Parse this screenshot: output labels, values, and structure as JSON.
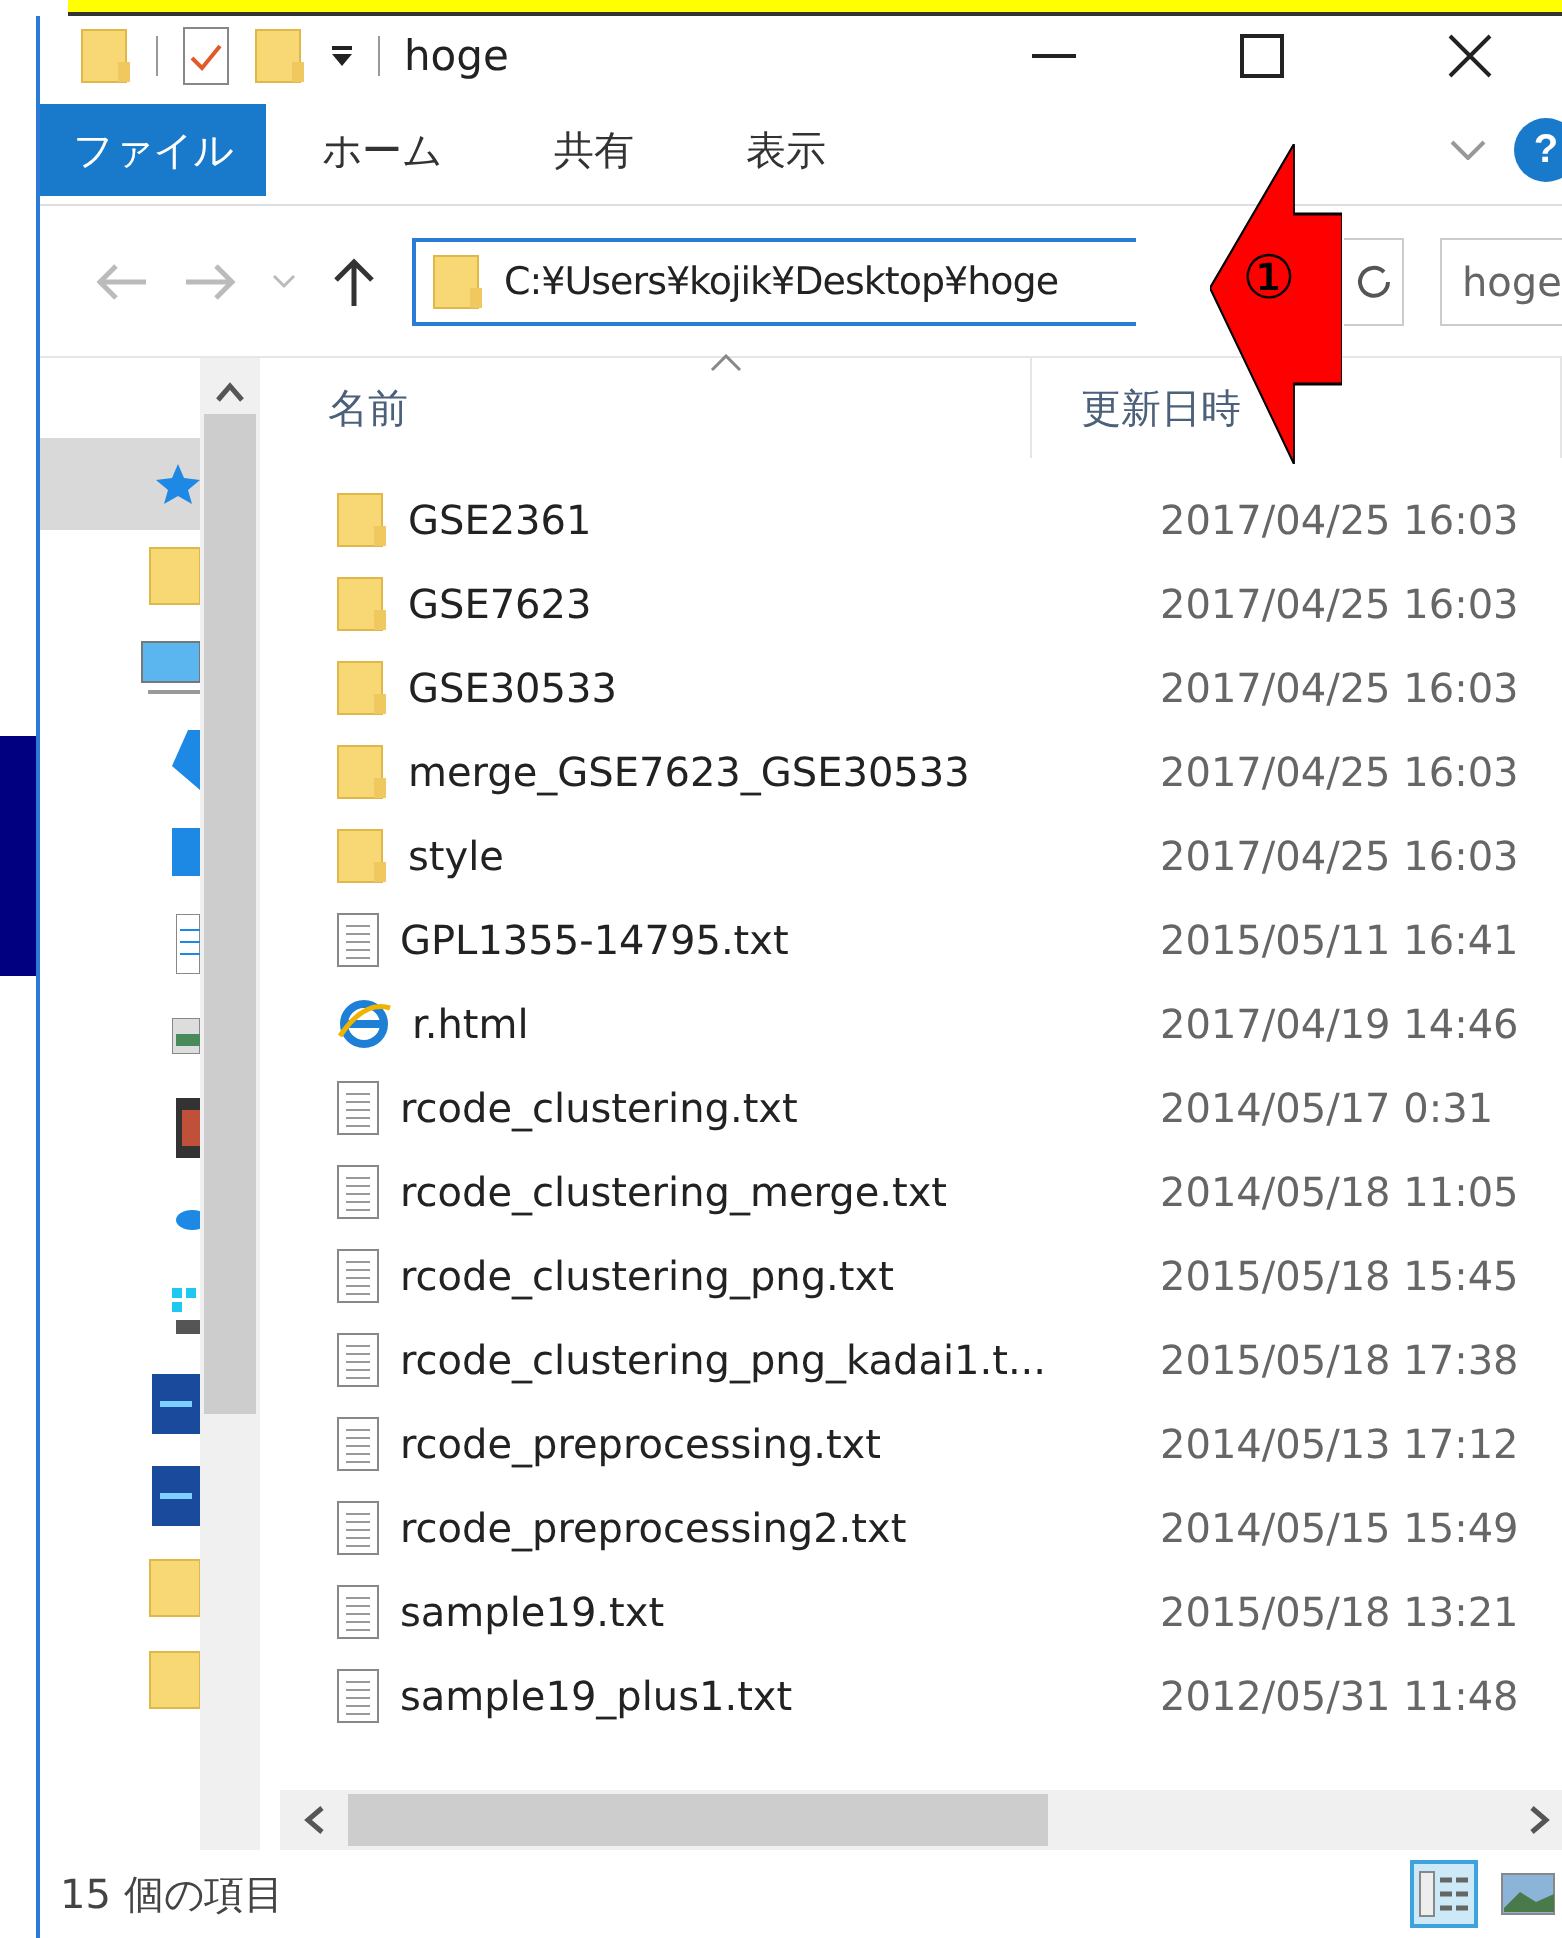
{
  "window": {
    "title": "hoge"
  },
  "ribbon": {
    "file_tab": "ファイル",
    "tabs": [
      "ホーム",
      "共有",
      "表示"
    ],
    "help": "?"
  },
  "address_bar": {
    "path": "C:¥Users¥kojik¥Desktop¥hoge",
    "search_placeholder": "hoge"
  },
  "annotation": {
    "label": "①"
  },
  "columns": [
    "名前",
    "更新日時"
  ],
  "rows": [
    {
      "kind": "folder",
      "name": "GSE2361",
      "date": "2017/04/25 16:03"
    },
    {
      "kind": "folder",
      "name": "GSE7623",
      "date": "2017/04/25 16:03"
    },
    {
      "kind": "folder",
      "name": "GSE30533",
      "date": "2017/04/25 16:03"
    },
    {
      "kind": "folder",
      "name": "merge_GSE7623_GSE30533",
      "date": "2017/04/25 16:03"
    },
    {
      "kind": "folder",
      "name": "style",
      "date": "2017/04/25 16:03"
    },
    {
      "kind": "text",
      "name": "GPL1355-14795.txt",
      "date": "2015/05/11 16:41"
    },
    {
      "kind": "html",
      "name": "r.html",
      "date": "2017/04/19 14:46"
    },
    {
      "kind": "text",
      "name": "rcode_clustering.txt",
      "date": "2014/05/17 0:31"
    },
    {
      "kind": "text",
      "name": "rcode_clustering_merge.txt",
      "date": "2014/05/18 11:05"
    },
    {
      "kind": "text",
      "name": "rcode_clustering_png.txt",
      "date": "2015/05/18 15:45"
    },
    {
      "kind": "text",
      "name": "rcode_clustering_png_kadai1.t...",
      "date": "2015/05/18 17:38"
    },
    {
      "kind": "text",
      "name": "rcode_preprocessing.txt",
      "date": "2014/05/13 17:12"
    },
    {
      "kind": "text",
      "name": "rcode_preprocessing2.txt",
      "date": "2014/05/15 15:49"
    },
    {
      "kind": "text",
      "name": "sample19.txt",
      "date": "2015/05/18 13:21"
    },
    {
      "kind": "text",
      "name": "sample19_plus1.txt",
      "date": "2012/05/31 11:48"
    }
  ],
  "status_bar": {
    "count": "15 個の項目"
  }
}
